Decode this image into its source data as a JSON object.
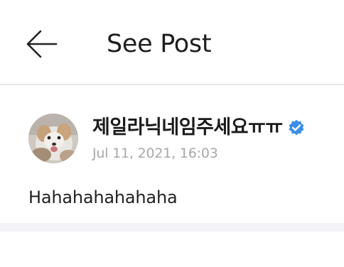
{
  "header": {
    "back_icon": "arrow-left-icon",
    "title": "See Post"
  },
  "post": {
    "author": "제일라닉네임주세요ㅠㅠ",
    "verified_icon": "verified-badge-icon",
    "verified_color": "#3b8ee8",
    "timestamp": "Jul 11, 2021, 16:03",
    "body": "Hahahahahahaha"
  }
}
